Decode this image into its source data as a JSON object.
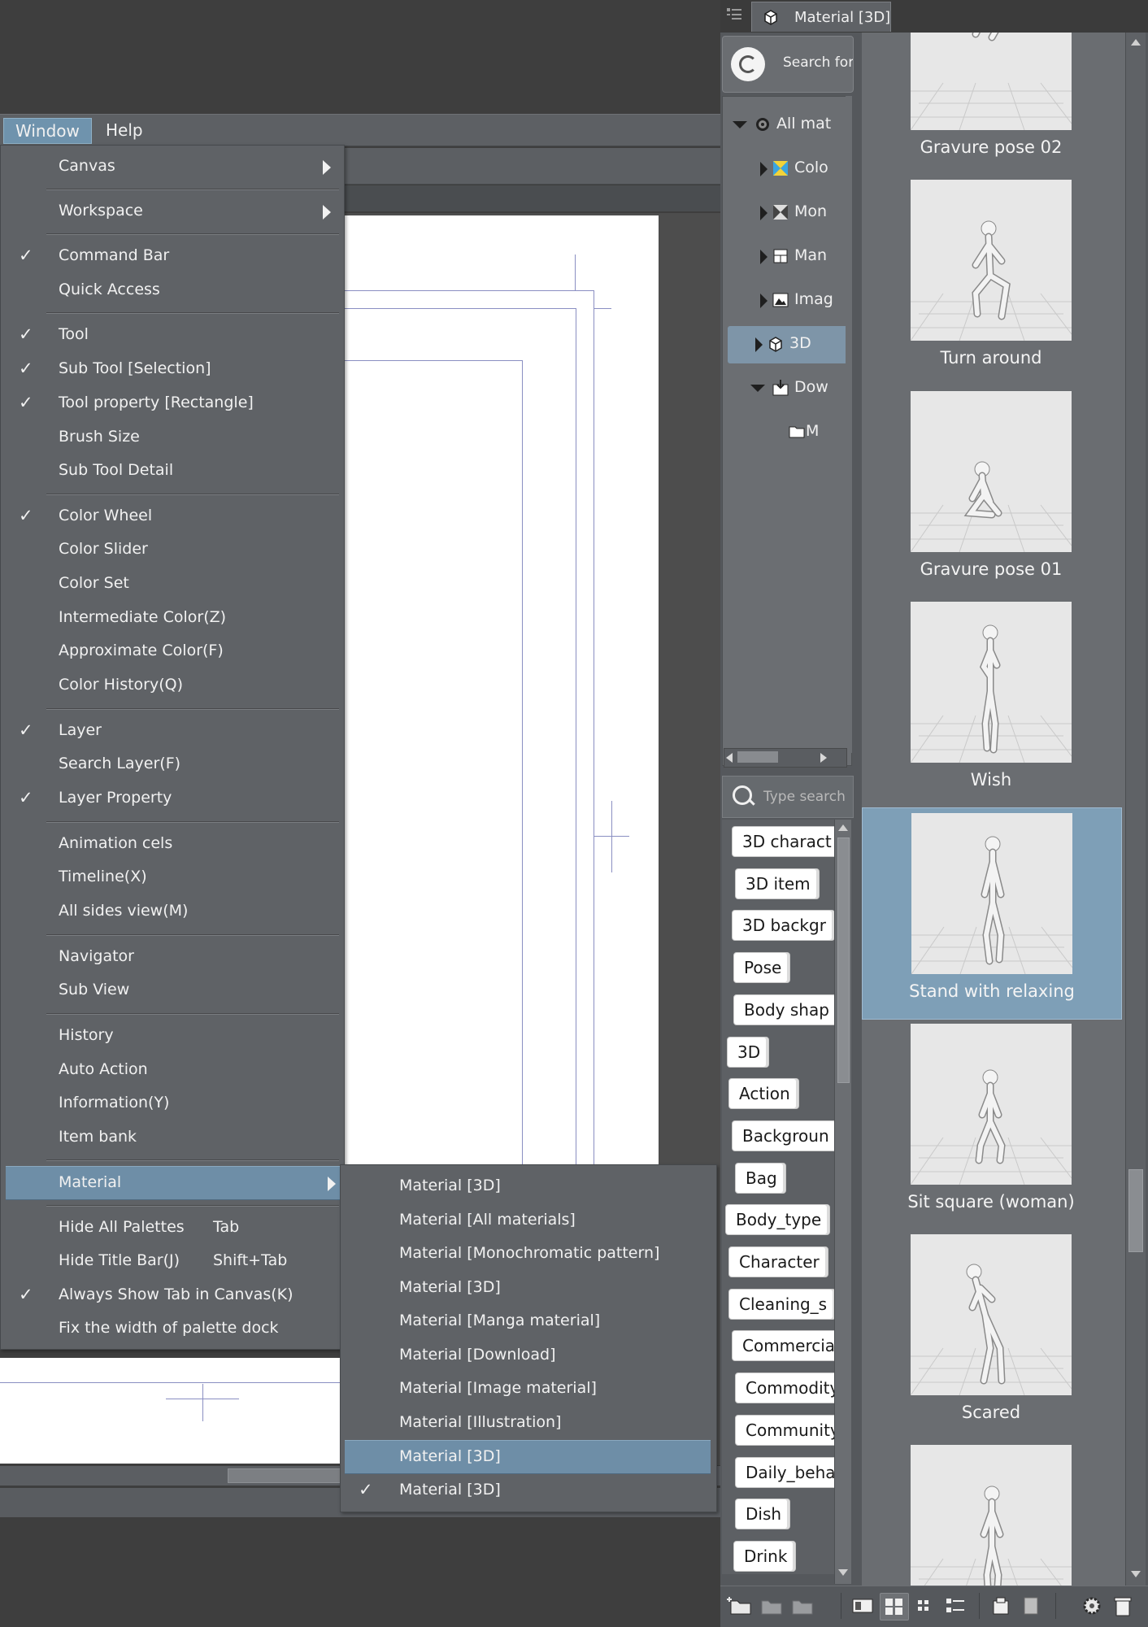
{
  "menubar": {
    "items": [
      "Window",
      "Help"
    ]
  },
  "window_menu": {
    "items": [
      {
        "label": "Canvas",
        "submenu": true
      },
      {
        "label": "Workspace",
        "submenu": true
      },
      {
        "label": "Command Bar",
        "checked": true
      },
      {
        "label": "Quick Access"
      },
      {
        "label": "Tool",
        "checked": true
      },
      {
        "label": "Sub Tool [Selection]",
        "checked": true
      },
      {
        "label": "Tool property [Rectangle]",
        "checked": true
      },
      {
        "label": "Brush Size"
      },
      {
        "label": "Sub Tool Detail"
      },
      {
        "label": "Color Wheel",
        "checked": true
      },
      {
        "label": "Color Slider"
      },
      {
        "label": "Color Set"
      },
      {
        "label": "Intermediate Color(Z)"
      },
      {
        "label": "Approximate Color(F)"
      },
      {
        "label": "Color History(Q)"
      },
      {
        "label": "Layer",
        "checked": true
      },
      {
        "label": "Search Layer(F)"
      },
      {
        "label": "Layer Property",
        "checked": true
      },
      {
        "label": "Animation cels"
      },
      {
        "label": "Timeline(X)"
      },
      {
        "label": "All sides view(M)"
      },
      {
        "label": "Navigator"
      },
      {
        "label": "Sub View"
      },
      {
        "label": "History"
      },
      {
        "label": "Auto Action"
      },
      {
        "label": "Information(Y)"
      },
      {
        "label": "Item bank"
      },
      {
        "label": "Material",
        "submenu": true,
        "highlighted": true
      },
      {
        "label": "Hide All Palettes",
        "shortcut": "Tab"
      },
      {
        "label": "Hide Title Bar(J)",
        "shortcut": "Shift+Tab"
      },
      {
        "label": "Always Show Tab in Canvas(K)",
        "checked": true
      },
      {
        "label": "Fix the width of palette dock"
      }
    ],
    "check_glyph": "✓"
  },
  "material_submenu": {
    "items": [
      {
        "label": "Material [3D]"
      },
      {
        "label": "Material [All materials]"
      },
      {
        "label": "Material [Monochromatic pattern]"
      },
      {
        "label": "Material [3D]"
      },
      {
        "label": "Material [Manga material]"
      },
      {
        "label": "Material [Download]"
      },
      {
        "label": "Material [Image material]"
      },
      {
        "label": "Material [Illustration]"
      },
      {
        "label": "Material [3D]",
        "highlighted": true
      },
      {
        "label": "Material [3D]",
        "checked": true
      }
    ]
  },
  "palette": {
    "tab_label": "Material [3D]",
    "search_button_label": "Search for",
    "tree": [
      {
        "label": "All mat",
        "expanded": true,
        "icon": "disc-icon"
      },
      {
        "label": "Colo",
        "icon": "color-pattern-icon"
      },
      {
        "label": "Mon",
        "icon": "monochrome-pattern-icon"
      },
      {
        "label": "Man",
        "icon": "manga-icon"
      },
      {
        "label": "Imag",
        "icon": "image-icon"
      },
      {
        "label": "3D",
        "icon": "3d-cube-icon",
        "selected": true
      },
      {
        "label": "Dow",
        "expanded": true,
        "icon": "download-icon"
      },
      {
        "label": "M",
        "icon": "folder-icon"
      }
    ],
    "tag_search_placeholder": "Type search",
    "tags": [
      "3D charact",
      "3D item",
      "3D backgr",
      "Pose",
      "Body shap",
      "3D",
      "Action",
      "Backgroun",
      "Bag",
      "Body_type",
      "Character",
      "Cleaning_s",
      "Commercia",
      "Commodity",
      "Community",
      "Daily_beha",
      "Dish",
      "Drink"
    ],
    "materials": [
      {
        "caption": "Gravure pose 02"
      },
      {
        "caption": "Turn around"
      },
      {
        "caption": "Gravure pose 01"
      },
      {
        "caption": "Wish"
      },
      {
        "caption": "Stand with relaxing",
        "selected": true
      },
      {
        "caption": "Sit square (woman)"
      },
      {
        "caption": "Scared"
      },
      {
        "caption": ""
      }
    ]
  },
  "colors": {
    "menu_bg": "#5f6266",
    "highlight": "#6e8ea7",
    "selected_card": "#7e9fb7",
    "paper": "#ffffff",
    "guide_lines": "#8a8fc2"
  }
}
